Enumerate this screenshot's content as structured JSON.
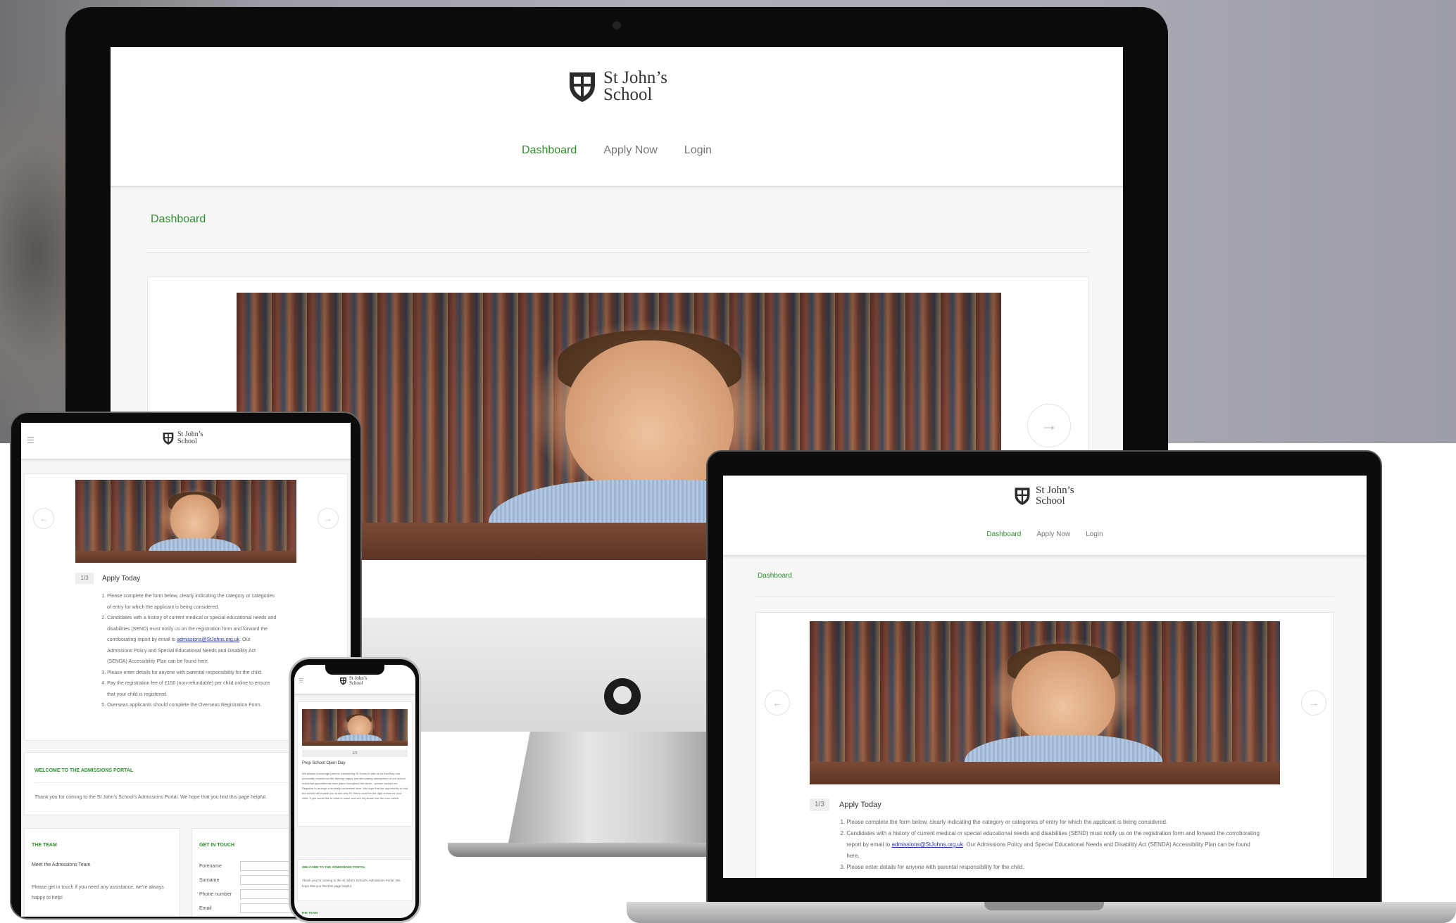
{
  "school": {
    "name_line1": "St John’s",
    "name_line2": "School",
    "logo_icon": "crest-shield-icon"
  },
  "nav": {
    "dashboard": "Dashboard",
    "apply_now": "Apply Now",
    "login": "Login"
  },
  "page": {
    "title": "Dashboard"
  },
  "carousel": {
    "pager": "1/3",
    "prev_icon": "arrow-left-icon",
    "next_icon": "arrow-right-icon",
    "phone_pager": "2/3"
  },
  "apply": {
    "heading": "Apply Today",
    "items": [
      "Please complete the form below, clearly indicating the category or categories of entry for which the applicant is being considered.",
      "Candidates with a history of current medical or special educational needs and disabilities (SEND) must notify us on the registration form and forward the corroborating report by email to",
      "Please enter details for anyone with parental responsibility for the child.",
      "Pay the registration fee of £150 (non-refundable) per child online to ensure that your child is registered.",
      "Overseas applicants should complete the Overseas Registration Form."
    ],
    "email": "admissions@StJohns.org.uk",
    "item2_tail": ". Our Admissions Policy and Special Educational Needs and Disability Act (SENDA) Accessibility Plan can be found here."
  },
  "welcome": {
    "title": "WELCOME TO THE ADMISSIONS PORTAL",
    "text": "Thank you for coming to the St John's School's Admissions Portal. We hope that you find this page helpful."
  },
  "team": {
    "title": "THE TEAM",
    "heading": "Meet the Admissions Team",
    "text": "Please get in touch if you need any assistance, we're always happy to help!"
  },
  "contact": {
    "title": "GET IN TOUCH",
    "fields": [
      "Forename",
      "Surname",
      "Phone number",
      "Email"
    ]
  },
  "open_day": {
    "title": "Prep School Open Day",
    "text": "We always encourage parents considering St Johns to visit us so that they can personally experience the friendly, happy and stimulating atmosphere of our school. Individual appointments take place throughout the week – please contact our Registrar to arrange a mutually convenient time. We hope that the opportunity to visit the school will enable you to see why St Johns could be the right choice for your child. If you would like to book to come and see us please use the form below."
  },
  "menu_icon": "hamburger-menu-icon"
}
